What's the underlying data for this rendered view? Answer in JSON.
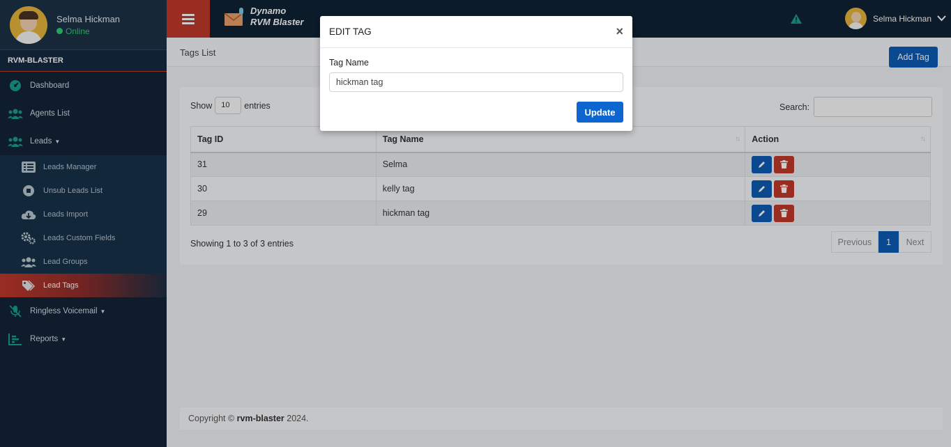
{
  "sidebar": {
    "user_name": "Selma Hickman",
    "user_status": "Online",
    "brand": "RVM-BLASTER",
    "nav": {
      "dashboard": "Dashboard",
      "agents": "Agents List",
      "leads": "Leads",
      "leads_manager": "Leads Manager",
      "unsub": "Unsub Leads List",
      "import": "Leads Import",
      "custom_fields": "Leads Custom Fields",
      "groups": "Lead Groups",
      "tags": "Lead Tags",
      "ringless": "Ringless Voicemail",
      "reports": "Reports"
    }
  },
  "header": {
    "logo_line1": "Dynamo",
    "logo_line2": "RVM Blaster",
    "user_name": "Selma Hickman"
  },
  "page": {
    "title": "Tags List",
    "add_button": "Add Tag",
    "show_label": "Show",
    "entries_value": "10",
    "entries_label": "entries",
    "search_label": "Search:",
    "columns": [
      "Tag ID",
      "Tag Name",
      "Action"
    ],
    "rows": [
      {
        "id": "31",
        "name": "Selma"
      },
      {
        "id": "30",
        "name": "kelly tag"
      },
      {
        "id": "29",
        "name": "hickman tag"
      }
    ],
    "info": "Showing 1 to 3 of 3 entries",
    "pager": {
      "prev": "Previous",
      "current": "1",
      "next": "Next"
    }
  },
  "footer": {
    "prefix": "Copyright ©",
    "brand": "rvm-blaster",
    "year": "2024."
  },
  "modal": {
    "title": "EDIT TAG",
    "close": "×",
    "field_label": "Tag Name",
    "field_value": "hickman tag",
    "submit": "Update"
  },
  "colors": {
    "accent_red": "#c0392b",
    "primary_blue": "#0d5bb5",
    "sidebar_bg": "#122338",
    "online_green": "#2ecc71",
    "warning_green": "#1a9e8f"
  }
}
